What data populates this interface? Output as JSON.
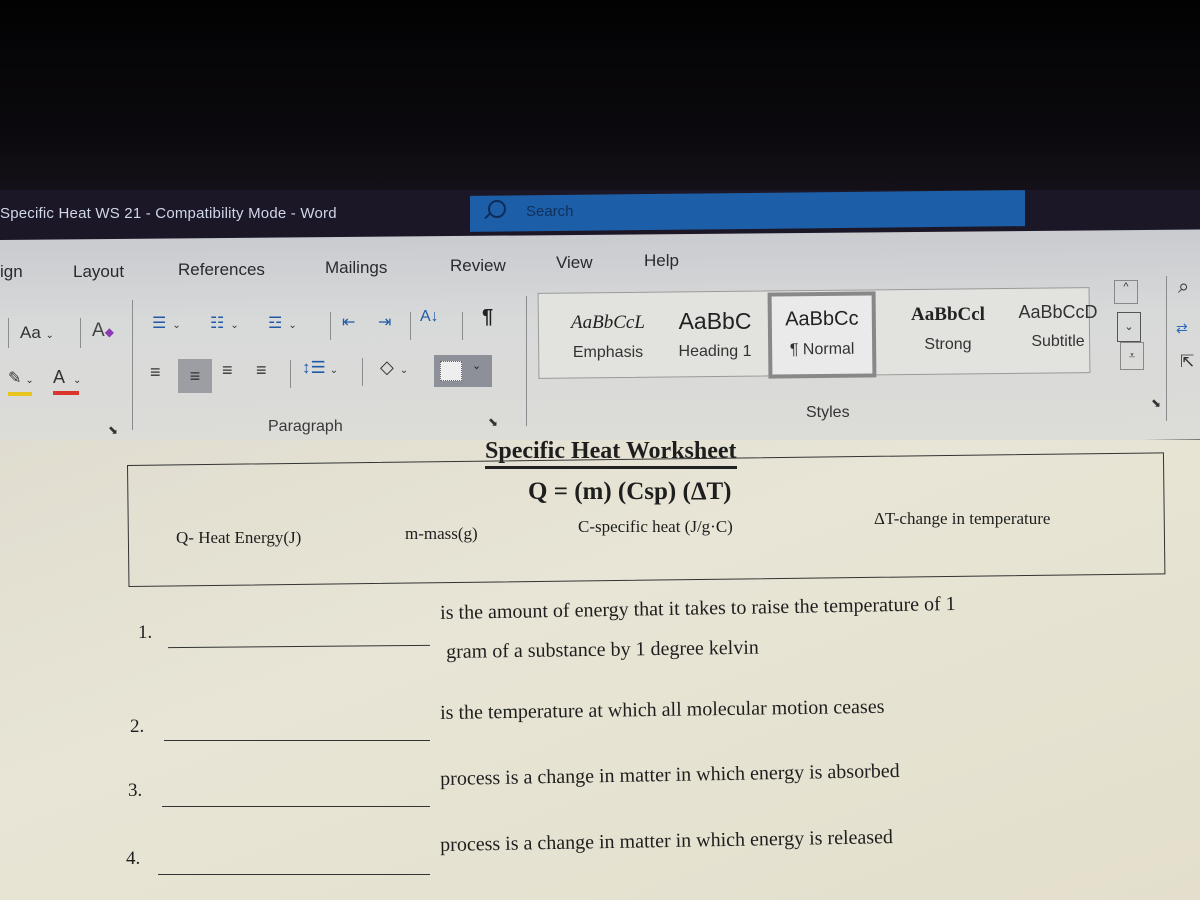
{
  "window": {
    "title": "Specific Heat WS 21  -  Compatibility Mode  -  Word",
    "search_placeholder": "Search"
  },
  "ribbon_tabs": [
    "ign",
    "Layout",
    "References",
    "Mailings",
    "Review",
    "View",
    "Help"
  ],
  "font_group": {
    "change_case": "Aa",
    "font_color_label": "A",
    "highlight_color": "#e8c51e",
    "font_color": "#d9352c"
  },
  "paragraph_group": {
    "label": "Paragraph",
    "pilcrow": "¶",
    "sort": "A↓"
  },
  "styles_group": {
    "label": "Styles",
    "items": [
      {
        "preview": "AaBbCcL",
        "name": "Emphasis"
      },
      {
        "preview": "AaBbC",
        "name": "Heading 1"
      },
      {
        "preview": "AaBbCc",
        "name": "¶ Normal",
        "selected": true
      },
      {
        "preview": "AaBbCcl",
        "name": "Strong"
      },
      {
        "preview": "AaBbCcD",
        "name": "Subtitle"
      }
    ]
  },
  "document": {
    "heading": "Specific Heat Worksheet",
    "formula": "Q = (m) (Csp) (ΔT)",
    "legend": [
      "Q- Heat Energy(J)",
      "m-mass(g)",
      "C-specific heat (J/g·C)",
      "ΔT-change in temperature"
    ],
    "questions": [
      {
        "num": "1.",
        "text_line1": "is the amount of energy that it takes to raise the temperature of 1",
        "text_line2": "gram of a substance by 1 degree kelvin"
      },
      {
        "num": "2.",
        "text_line1": "is the temperature at which all molecular motion ceases"
      },
      {
        "num": "3.",
        "text_line1": "process is a change in matter in which energy is absorbed"
      },
      {
        "num": "4.",
        "text_line1": "process is a change in matter in which energy is released"
      }
    ]
  }
}
